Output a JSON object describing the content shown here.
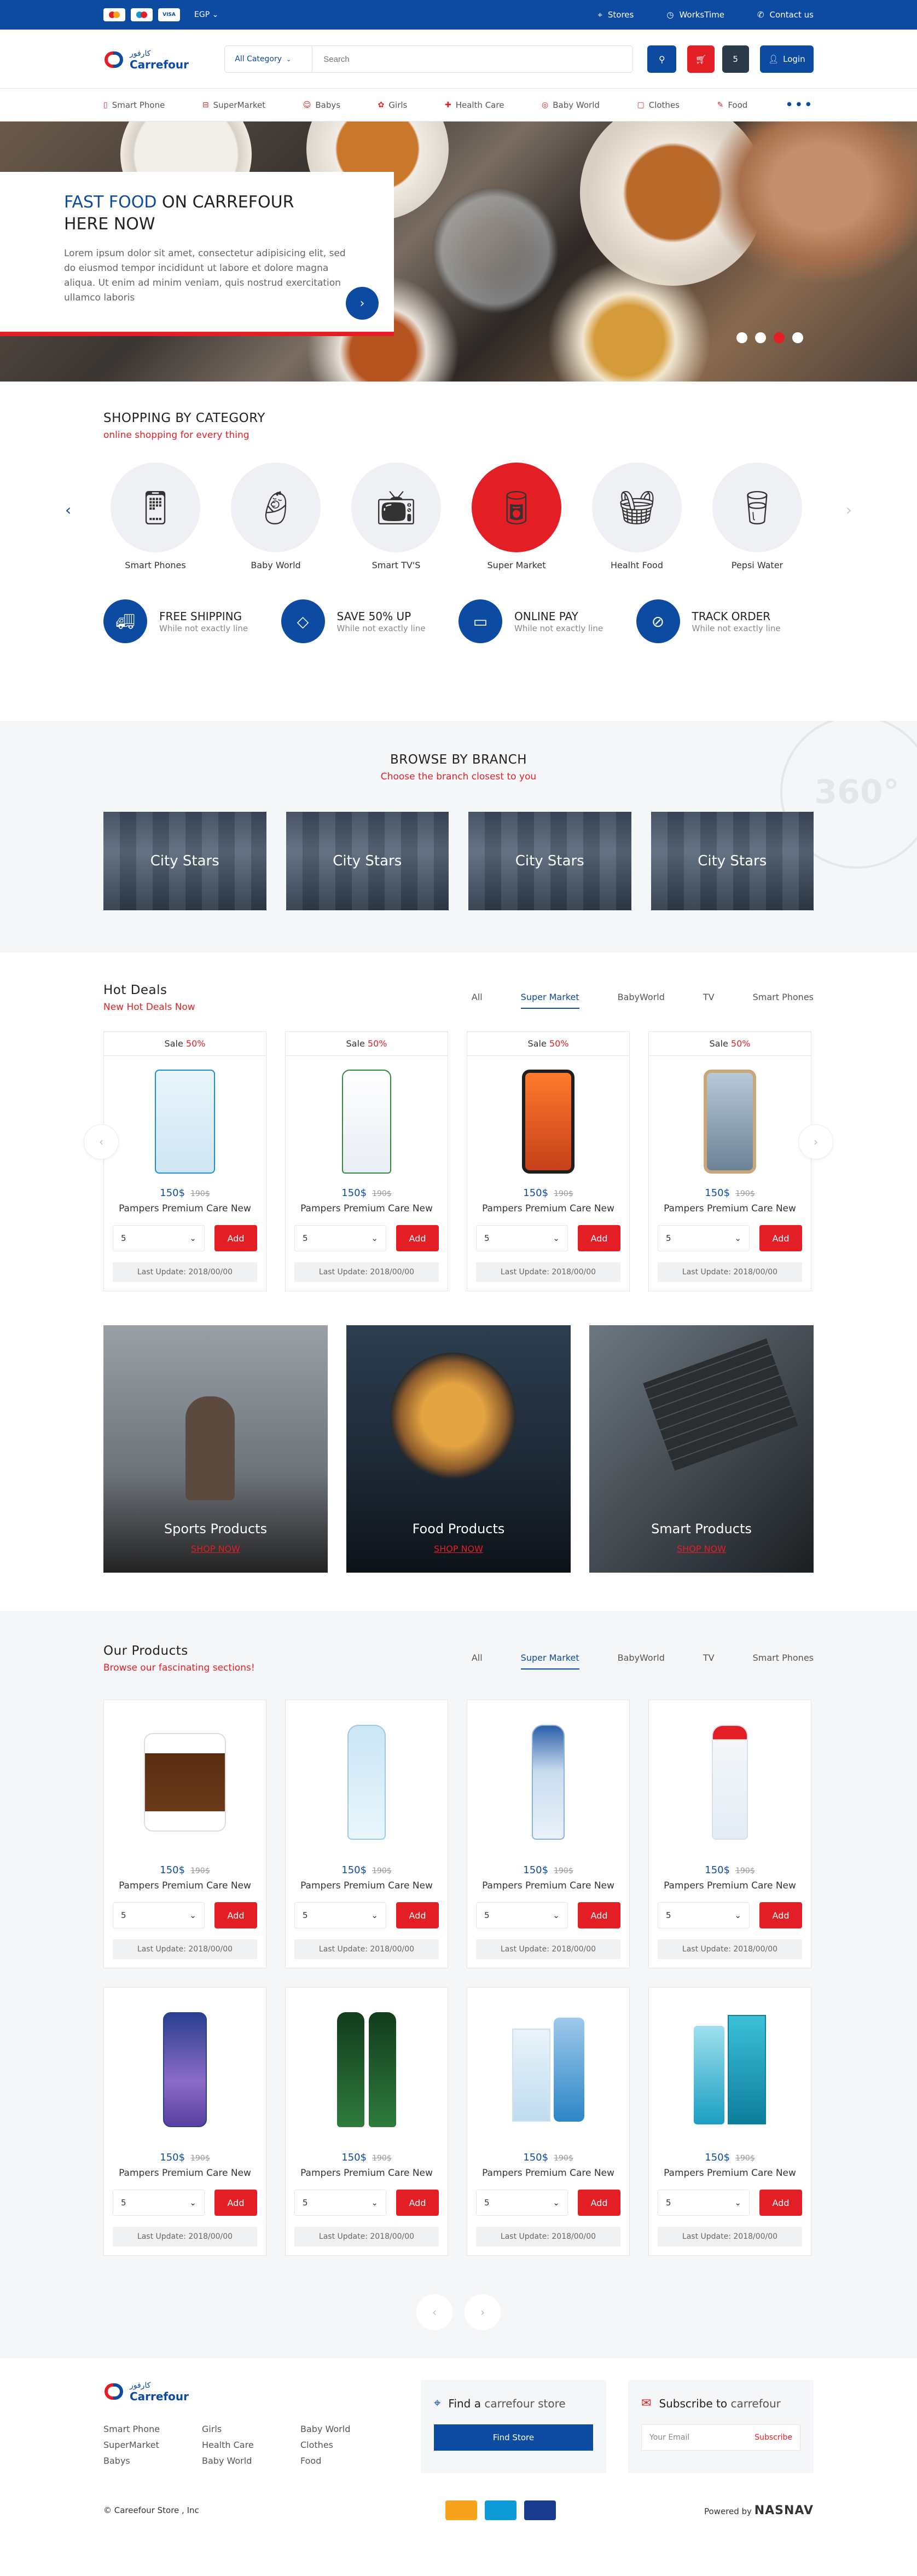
{
  "topbar": {
    "cards": [
      "MC",
      "Maestro",
      "VISA"
    ],
    "currency": "EGP ⌄",
    "links": [
      {
        "icon": "map-pin-icon",
        "label": "Stores"
      },
      {
        "icon": "clock-icon",
        "label": "WorksTime"
      },
      {
        "icon": "phone-icon",
        "label": "Contact us"
      }
    ]
  },
  "header": {
    "logo_arabic": "كارفور",
    "logo_name": "Carrefour",
    "category_select": "All Category",
    "search_placeholder": "Search",
    "cart_count": "5",
    "login_label": "Login"
  },
  "nav": [
    "Smart Phone",
    "SuperMarket",
    "Babys",
    "Girls",
    "Health Care",
    "Baby World",
    "Clothes",
    "Food"
  ],
  "hero": {
    "title_highlight": "FAST FOOD",
    "title_rest": " ON CARREFOUR HERE NOW",
    "body": "Lorem ipsum dolor sit amet, consectetur adipisicing elit, sed do eiusmod tempor incididunt ut labore et dolore magna aliqua. Ut enim ad minim veniam, quis nostrud exercitation ullamco laboris",
    "slide_count": 4,
    "active_slide": 3
  },
  "category": {
    "title": "SHOPPING BY CATEGORY",
    "subtitle": "online shopping for every thing",
    "items": [
      "Smart Phones",
      "Baby World",
      "Smart TV'S",
      "Super Market",
      "Healht Food",
      "Pepsi Water"
    ]
  },
  "features": [
    {
      "title": "FREE SHIPPING",
      "sub": "While not exactly line"
    },
    {
      "title": "SAVE 50% UP",
      "sub": "While not exactly line"
    },
    {
      "title": "ONLINE PAY",
      "sub": "While not exactly line"
    },
    {
      "title": "TRACK ORDER",
      "sub": "While not exactly line"
    }
  ],
  "branch": {
    "title": "BROWSE BY BRANCH",
    "subtitle": "Choose the branch closest to you",
    "badge": "360°",
    "cards": [
      "City Stars",
      "City Stars",
      "City Stars",
      "City Stars"
    ]
  },
  "tabs": [
    "All",
    "Super Market",
    "BabyWorld",
    "TV",
    "Smart Phones"
  ],
  "deals": {
    "title": "Hot Deals",
    "subtitle": "New Hot Deals Now",
    "sale_label": "Sale ",
    "sale_pct": "50%",
    "products": [
      {
        "price": "150$",
        "old": "190$",
        "name": "Pampers Premium Care New",
        "qty": "5"
      },
      {
        "price": "150$",
        "old": "190$",
        "name": "Pampers Premium Care New",
        "qty": "5"
      },
      {
        "price": "150$",
        "old": "190$",
        "name": "Pampers Premium Care New",
        "qty": "5"
      },
      {
        "price": "150$",
        "old": "190$",
        "name": "Pampers Premium Care New",
        "qty": "5"
      }
    ]
  },
  "add_label": "Add",
  "last_update": "Last Update: 2018/00/00",
  "promos": [
    {
      "title": "Sports Products",
      "cta": "SHOP NOW"
    },
    {
      "title": "Food Products",
      "cta": "SHOP NOW"
    },
    {
      "title": "Smart Products",
      "cta": "SHOP NOW"
    }
  ],
  "ours": {
    "title": "Our Products",
    "subtitle": "Browse our fascinating sections!",
    "products": [
      {
        "price": "150$",
        "old": "190$",
        "name": "Pampers Premium Care New",
        "qty": "5"
      },
      {
        "price": "150$",
        "old": "190$",
        "name": "Pampers Premium Care New",
        "qty": "5"
      },
      {
        "price": "150$",
        "old": "190$",
        "name": "Pampers Premium Care New",
        "qty": "5"
      },
      {
        "price": "150$",
        "old": "190$",
        "name": "Pampers Premium Care New",
        "qty": "5"
      },
      {
        "price": "150$",
        "old": "190$",
        "name": "Pampers Premium Care New",
        "qty": "5"
      },
      {
        "price": "150$",
        "old": "190$",
        "name": "Pampers Premium Care New",
        "qty": "5"
      },
      {
        "price": "150$",
        "old": "190$",
        "name": "Pampers Premium Care New",
        "qty": "5"
      },
      {
        "price": "150$",
        "old": "190$",
        "name": "Pampers Premium Care New",
        "qty": "5"
      }
    ]
  },
  "footer": {
    "links": [
      "Smart Phone",
      "Girls",
      "Baby World",
      "SuperMarket",
      "Health Care",
      "Clothes",
      "Babys",
      "Baby World",
      "Food"
    ],
    "find_title": "Find a",
    "find_rest": " carrefour store",
    "find_btn": "Find Store",
    "subscribe_title": "Subscribe to",
    "subscribe_rest": " carrefour",
    "email_placeholder": "Your Email",
    "subscribe_btn": "Subscribe",
    "copyright": "© Careefour Store , Inc",
    "powered": "Powered by",
    "powered_brand": "NASNAV"
  },
  "colors": {
    "primary": "#0d4aa1",
    "accent": "#e31e24"
  }
}
